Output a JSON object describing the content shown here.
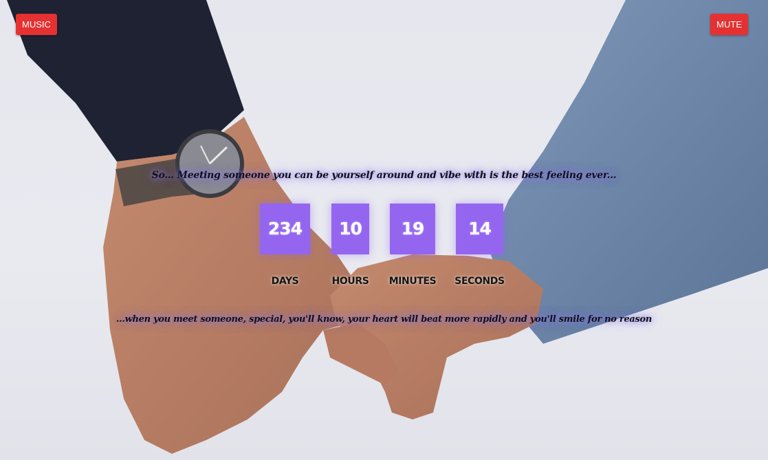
{
  "header": {
    "music_label": "MUSIC",
    "mute_label": "MUTE"
  },
  "quotes": {
    "top": "So... Meeting someone you can be yourself around and vibe with is the best feeling ever...",
    "bottom": "...when you meet someone, special, you'll know, your heart will beat more rapidly and you'll smile for no reason"
  },
  "countdown": {
    "days": {
      "value": "234",
      "label": "DAYS"
    },
    "hours": {
      "value": "10",
      "label": "HOURS"
    },
    "minutes": {
      "value": "19",
      "label": "MINUTES"
    },
    "seconds": {
      "value": "14",
      "label": "SECONDS"
    }
  },
  "colors": {
    "button": "#e53131",
    "counter_box": "#9466f0",
    "glow": "#8c78ff"
  }
}
